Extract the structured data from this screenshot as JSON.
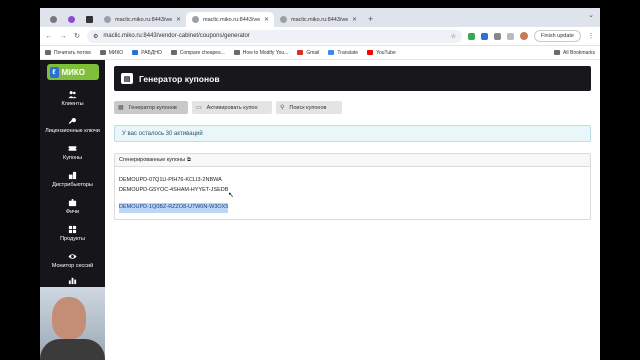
{
  "browser": {
    "tabs": [
      {
        "title": "maclic.miko.ru:8443/vendo",
        "active": false
      },
      {
        "title": "maclic.miko.ru:8443/vendo",
        "active": true
      },
      {
        "title": "maclic.miko.ru:8443/vendo",
        "active": false
      }
    ],
    "url": "maclic.miko.ru:8443/vendor-cabinet/coupons/generator",
    "finish_update": "Finish update",
    "bookmarks": [
      "Почитать потом",
      "МИКО",
      "РАБДНО",
      "Compare cheapes...",
      "How to Modify You...",
      "Gmail",
      "Translate",
      "YouTube"
    ],
    "all_bookmarks": "All Bookmarks"
  },
  "sidebar": {
    "logo": "МИКО",
    "items": [
      {
        "label": "Клиенты",
        "icon": "users-icon"
      },
      {
        "label": "Лицензионные ключи",
        "icon": "key-icon"
      },
      {
        "label": "Купоны",
        "icon": "coupon-icon"
      },
      {
        "label": "Дистрибьюторы",
        "icon": "distributors-icon"
      },
      {
        "label": "Фичи",
        "icon": "puzzle-icon"
      },
      {
        "label": "Продукты",
        "icon": "grid-icon"
      },
      {
        "label": "Монитор сессий",
        "icon": "eye-icon"
      }
    ]
  },
  "page": {
    "title": "Генератор купонов",
    "tabs": [
      {
        "label": "Генератор купонов",
        "active": true
      },
      {
        "label": "Активировать купон",
        "active": false
      },
      {
        "label": "Поиск купонов",
        "active": false
      }
    ],
    "activations_info": "У вас осталось 30 активаций",
    "generated": {
      "title": "Сгенерированные купоны",
      "codes": [
        "DEMOUPD-07Q1U-PIH76-KCLI3-2NBWA",
        "DEMOUPD-G5YOC-4SHAM-HYYET-JSEDB",
        "DEMOUPD-1Q0BZ-RZZO8-U7W0N-W3OX5"
      ]
    }
  }
}
